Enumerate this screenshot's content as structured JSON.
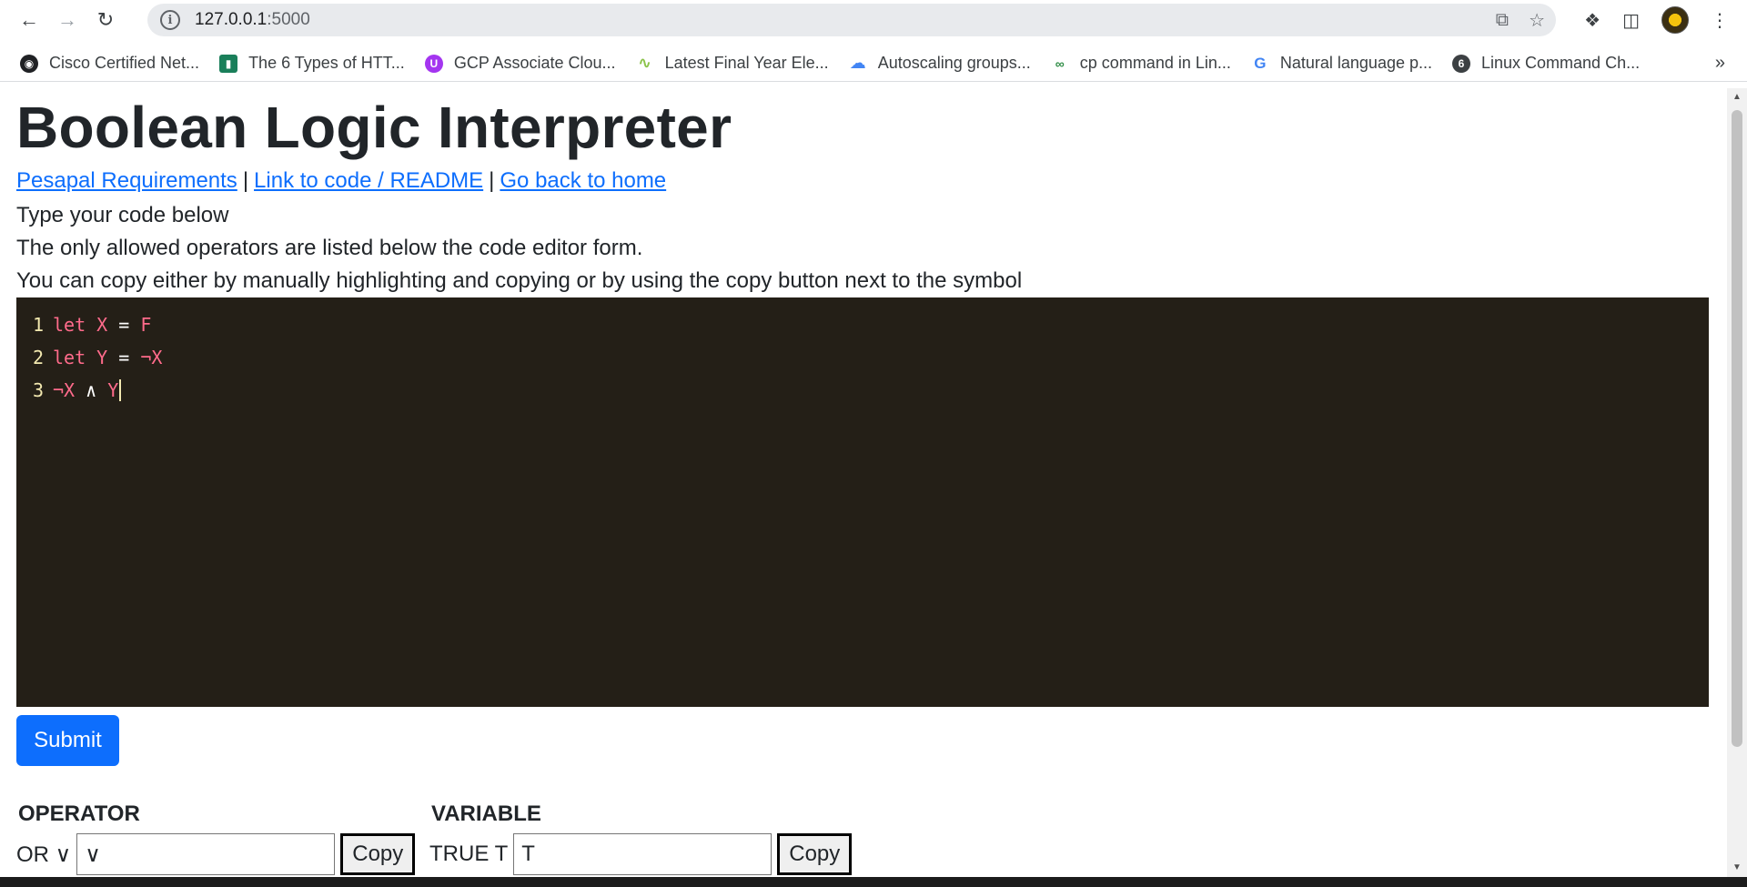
{
  "browser": {
    "url_host": "127.0.0.1",
    "url_port": ":5000",
    "bookmarks": [
      {
        "label": "Cisco Certified Net...",
        "icon": "globe-icon",
        "color": "#202124"
      },
      {
        "label": "The 6 Types of HTT...",
        "icon": "site-icon",
        "color": "#1a7f5a"
      },
      {
        "label": "GCP Associate Clou...",
        "icon": "udemy-icon",
        "color": "#a435f0"
      },
      {
        "label": "Latest Final Year Ele...",
        "icon": "leaf-icon",
        "color": "#8bc34a"
      },
      {
        "label": "Autoscaling groups...",
        "icon": "gcloud-icon",
        "color": "#4285f4"
      },
      {
        "label": "cp command in Lin...",
        "icon": "gfg-icon",
        "color": "#2f8d46"
      },
      {
        "label": "Natural language p...",
        "icon": "google-icon",
        "color": "#4285f4"
      },
      {
        "label": "Linux Command Ch...",
        "icon": "linux-icon",
        "color": "#3c4043"
      }
    ]
  },
  "page": {
    "title": "Boolean Logic Interpreter",
    "links": {
      "requirements": "Pesapal Requirements",
      "separator": "|",
      "code": "Link to code / README",
      "home": "Go back to home"
    },
    "para1": "Type your code below",
    "para2": "The only allowed operators are listed below the code editor form.",
    "para3": "You can copy either by manually highlighting and copying or by using the copy button next to the symbol",
    "editor": {
      "lines": [
        {
          "num": "1",
          "kw": "let",
          "id": "X",
          "op": "=",
          "val": "F"
        },
        {
          "num": "2",
          "kw": "let",
          "id": "Y",
          "op": "=",
          "val": "¬X"
        },
        {
          "num": "3",
          "expr_a": "¬X",
          "op": "∧",
          "expr_b": "Y"
        }
      ]
    },
    "submit_label": "Submit",
    "operator": {
      "heading": "OPERATOR",
      "label": "OR ∨",
      "value": "∨",
      "copy_label": "Copy"
    },
    "variable": {
      "heading": "VARIABLE",
      "label": "TRUE T",
      "value": "T",
      "copy_label": "Copy"
    }
  }
}
